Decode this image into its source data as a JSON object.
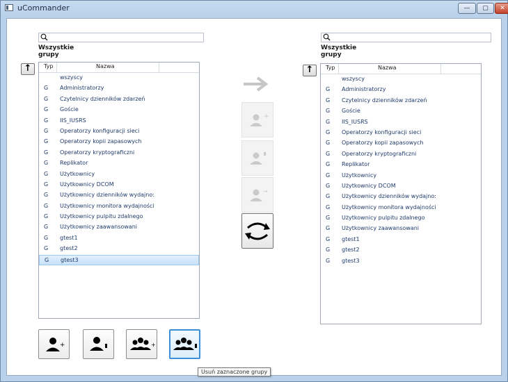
{
  "window": {
    "title": "uCommander",
    "min_symbol": "—",
    "max_symbol": "▢",
    "close_symbol": "✕"
  },
  "left_panel": {
    "search": {
      "value": "",
      "icon": "search-icon"
    },
    "heading": "Wszystkie grupy",
    "up_label": "↑",
    "columns": {
      "type": "Typ",
      "name": "Nazwa"
    },
    "rows": [
      {
        "type": "",
        "name": "wszyscy"
      },
      {
        "type": "G",
        "name": "Administratorzy"
      },
      {
        "type": "G",
        "name": "Czytelnicy dzienników zdarzeń"
      },
      {
        "type": "G",
        "name": "Goście"
      },
      {
        "type": "G",
        "name": "IIS_IUSRS"
      },
      {
        "type": "G",
        "name": "Operatorzy konfiguracji sieci"
      },
      {
        "type": "G",
        "name": "Operatorzy kopii zapasowych"
      },
      {
        "type": "G",
        "name": "Operatorzy kryptograficzni"
      },
      {
        "type": "G",
        "name": "Replikator"
      },
      {
        "type": "G",
        "name": "Użytkownicy"
      },
      {
        "type": "G",
        "name": "Użytkownicy DCOM"
      },
      {
        "type": "G",
        "name": "Użytkownicy dzienników wydajno:"
      },
      {
        "type": "G",
        "name": "Użytkownicy monitora wydajności"
      },
      {
        "type": "G",
        "name": "Użytkownicy pulpitu zdalnego"
      },
      {
        "type": "G",
        "name": "Użytkownicy zaawansowani"
      },
      {
        "type": "G",
        "name": "gtest1"
      },
      {
        "type": "G",
        "name": "gtest2"
      },
      {
        "type": "G",
        "name": "gtest3"
      }
    ],
    "selected_row": "gtest3"
  },
  "right_panel": {
    "search": {
      "value": "",
      "icon": "search-icon"
    },
    "heading": "Wszystkie grupy",
    "up_label": "↑",
    "columns": {
      "type": "Typ",
      "name": "Nazwa"
    },
    "rows": [
      {
        "type": "",
        "name": "wszyscy"
      },
      {
        "type": "G",
        "name": "Administratorzy"
      },
      {
        "type": "G",
        "name": "Czytelnicy dzienników zdarzeń"
      },
      {
        "type": "G",
        "name": "Goście"
      },
      {
        "type": "G",
        "name": "IIS_IUSRS"
      },
      {
        "type": "G",
        "name": "Operatorzy konfiguracji sieci"
      },
      {
        "type": "G",
        "name": "Operatorzy kopii zapasowych"
      },
      {
        "type": "G",
        "name": "Operatorzy kryptograficzni"
      },
      {
        "type": "G",
        "name": "Replikator"
      },
      {
        "type": "G",
        "name": "Użytkownicy"
      },
      {
        "type": "G",
        "name": "Użytkownicy DCOM"
      },
      {
        "type": "G",
        "name": "Użytkownicy dzienników wydajno:"
      },
      {
        "type": "G",
        "name": "Użytkownicy monitora wydajności"
      },
      {
        "type": "G",
        "name": "Użytkownicy pulpitu zdalnego"
      },
      {
        "type": "G",
        "name": "Użytkownicy zaawansowani"
      },
      {
        "type": "G",
        "name": "gtest1"
      },
      {
        "type": "G",
        "name": "gtest2"
      },
      {
        "type": "G",
        "name": "gtest3"
      }
    ]
  },
  "middle_controls": {
    "transfer_icon": "arrow-right-icon",
    "buttons": [
      {
        "icon": "add-user-to-group-icon",
        "enabled": false
      },
      {
        "icon": "remove-user-from-group-icon",
        "enabled": false
      },
      {
        "icon": "move-user-icon",
        "enabled": false
      },
      {
        "icon": "refresh-icon",
        "enabled": true
      }
    ]
  },
  "bottom_buttons": [
    {
      "icon": "add-user-icon"
    },
    {
      "icon": "remove-user-icon"
    },
    {
      "icon": "add-group-icon"
    },
    {
      "icon": "remove-group-icon",
      "focused": true
    }
  ],
  "tooltip": "Usuń zaznaczone grupy",
  "colors": {
    "row_text": "#1f3a6a",
    "selection": "#c7e2f9",
    "disabled_icon": "#c8c8c8",
    "focus_border": "#3c8fd6"
  }
}
